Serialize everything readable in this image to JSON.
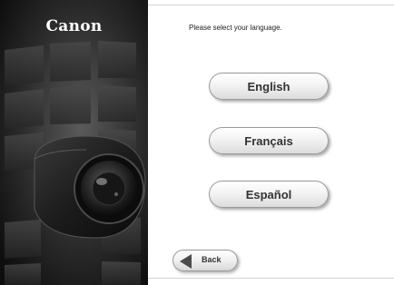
{
  "brand": {
    "logo_text": "Canon"
  },
  "prompt": {
    "text": "Please select your language."
  },
  "languages": [
    {
      "label": "English"
    },
    {
      "label": "Français"
    },
    {
      "label": "Español"
    }
  ],
  "navigation": {
    "back_label": "Back",
    "back_icon": "left-arrow-icon"
  },
  "colors": {
    "left_panel_bg": "#151515",
    "button_text": "#333333"
  }
}
